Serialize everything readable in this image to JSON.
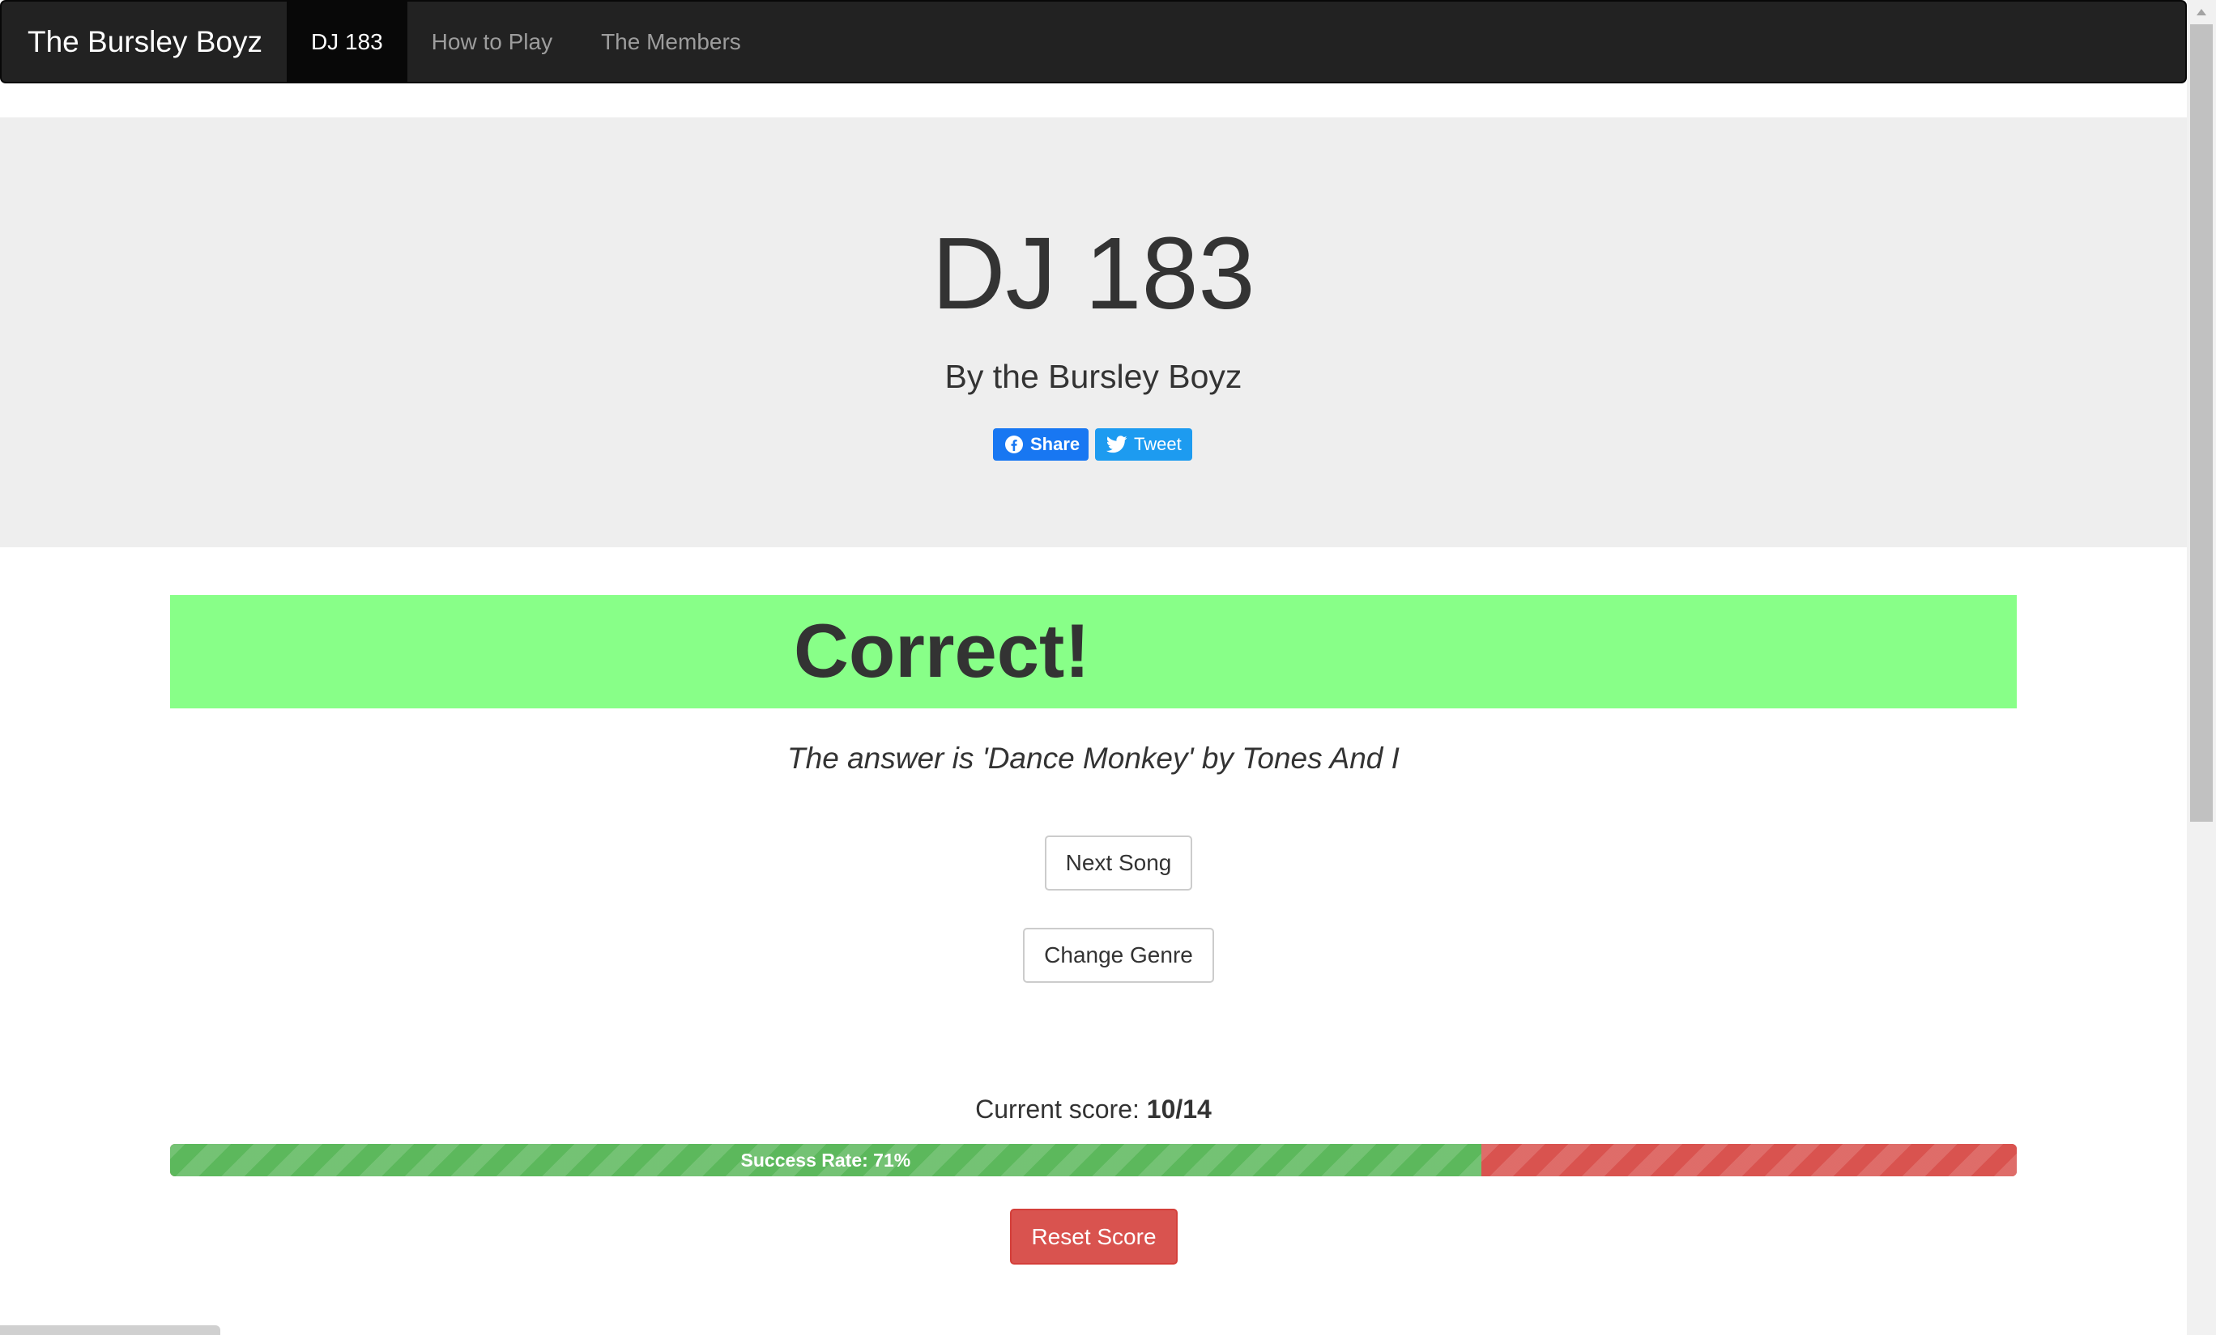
{
  "navbar": {
    "brand": "The Bursley Boyz",
    "items": [
      {
        "label": "DJ 183",
        "active": true
      },
      {
        "label": "How to Play",
        "active": false
      },
      {
        "label": "The Members",
        "active": false
      }
    ]
  },
  "jumbotron": {
    "title": "DJ 183",
    "subtitle": "By the Bursley Boyz",
    "share": {
      "facebook_label": "Share",
      "twitter_label": "Tweet",
      "facebook_icon": "facebook-icon",
      "twitter_icon": "twitter-icon"
    }
  },
  "result": {
    "heading": "Correct!",
    "answer": "The answer is 'Dance Monkey' by Tones And I",
    "banner_color": "#88ff88"
  },
  "actions": {
    "next_song": "Next Song",
    "change_genre": "Change Genre",
    "reset_score": "Reset Score"
  },
  "score": {
    "label": "Current score: ",
    "value": "10/14",
    "success_rate_label": "Success Rate: 71%",
    "success_fraction": 0.71,
    "success_color": "#5cb85c",
    "fail_color": "#d9534f"
  }
}
